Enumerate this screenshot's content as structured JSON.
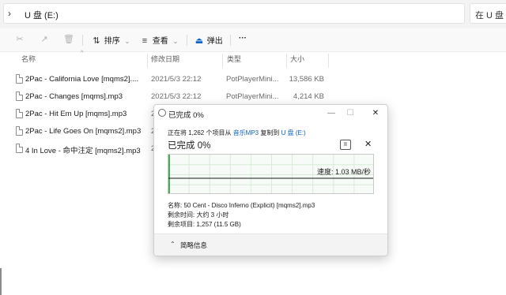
{
  "address_bar": {
    "chevron_icon": "chevron-right-icon",
    "path": "U 盘 (E:)",
    "search_placeholder": "在 U 盘"
  },
  "toolbar": {
    "icons": [
      "cut-icon",
      "share-icon",
      "delete-icon"
    ],
    "sort_label": "排序",
    "view_label": "查看",
    "eject_label": "弹出",
    "more_label": "···"
  },
  "columns": {
    "name": "名称",
    "modified": "修改日期",
    "type": "类型",
    "size": "大小"
  },
  "files": [
    {
      "name": "2Pac - California Love [mqms2]....",
      "modified": "2021/5/3 22:12",
      "type": "PotPlayerMini...",
      "size": "13,586 KB"
    },
    {
      "name": "2Pac - Changes [mqms].mp3",
      "modified": "2021/5/3 22:12",
      "type": "PotPlayerMini...",
      "size": "4,214 KB"
    },
    {
      "name": "2Pac - Hit Em Up [mqms].mp3",
      "modified": "2",
      "type": "",
      "size": ""
    },
    {
      "name": "2Pac - Life Goes On [mqms2].mp3",
      "modified": "2",
      "type": "",
      "size": ""
    },
    {
      "name": "4 In Love - 命中注定 [mqms2].mp3",
      "modified": "2",
      "type": "",
      "size": ""
    }
  ],
  "dialog": {
    "title": "已完成 0%",
    "copy_prefix": "正在将 1,262 个项目从 ",
    "copy_source": "音乐MP3",
    "copy_middle": " 复制到 ",
    "copy_dest": "U 盘 (E:)",
    "big_status": "已完成 0%",
    "pause_symbol": "II",
    "cancel_symbol": "✕",
    "speed": "速度: 1.03 MB/秒",
    "progress_fraction": 0.0,
    "name_line": "名称:  50 Cent - Disco Inferno (Explicit) [mqms2].mp3",
    "time_line": "剩余时间:  大约 3 小时",
    "items_line": "剩余项目:  1,257 (11.5 GB)",
    "details_label": "简略信息",
    "window_buttons": {
      "minimize": "—",
      "maximize": "☐",
      "close": "✕"
    },
    "accent_green": "#2e9e3a",
    "link_color": "#0a62c7"
  }
}
